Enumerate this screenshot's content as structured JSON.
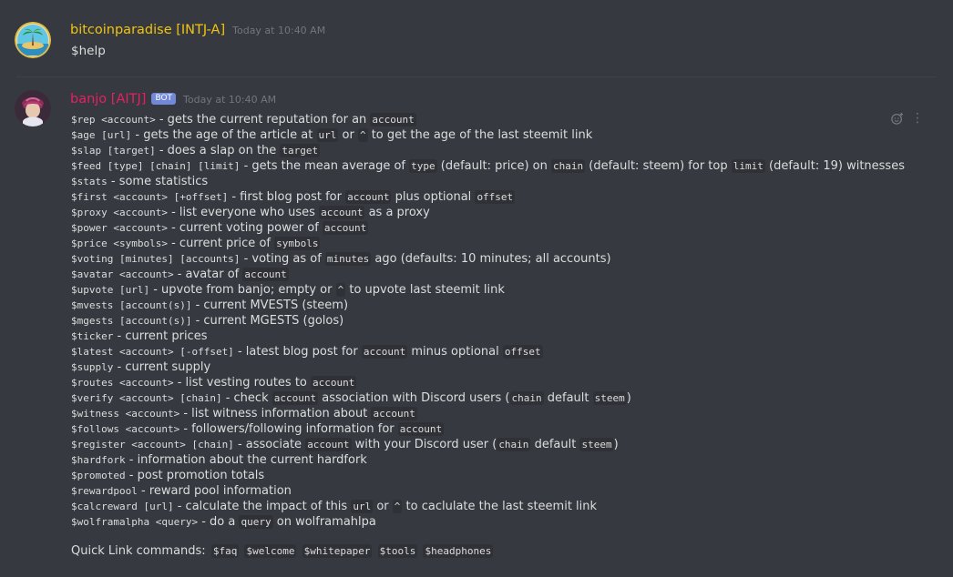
{
  "messages": [
    {
      "username": "bitcoinparadise [INTJ-A]",
      "username_color": "#f1c40f",
      "timestamp": "Today at 10:40 AM",
      "text": "$help"
    },
    {
      "username": "banjo [AITJ]",
      "username_color": "#e91e63",
      "bot_badge": "BOT",
      "timestamp": "Today at 10:40 AM"
    }
  ],
  "help_lines": [
    [
      {
        "c": "$rep <account>"
      },
      {
        "t": " - gets the current reputation for an "
      },
      {
        "c": "account"
      }
    ],
    [
      {
        "c": "$age [url]"
      },
      {
        "t": " - gets the age of the article at "
      },
      {
        "c": "url"
      },
      {
        "t": " or "
      },
      {
        "c": "^"
      },
      {
        "t": " to get the age of the last steemit link"
      }
    ],
    [
      {
        "c": "$slap [target]"
      },
      {
        "t": " - does a slap on the "
      },
      {
        "c": "target"
      }
    ],
    [
      {
        "c": "$feed [type] [chain] [limit]"
      },
      {
        "t": " - gets the mean average of "
      },
      {
        "c": "type"
      },
      {
        "t": " (default: price) on "
      },
      {
        "c": "chain"
      },
      {
        "t": " (default: steem) for top "
      },
      {
        "c": "limit"
      },
      {
        "t": " (default: 19) witnesses"
      }
    ],
    [
      {
        "c": "$stats"
      },
      {
        "t": " - some statistics"
      }
    ],
    [
      {
        "c": "$first <account> [+offset]"
      },
      {
        "t": " - first blog post for "
      },
      {
        "c": "account"
      },
      {
        "t": " plus optional "
      },
      {
        "c": "offset"
      }
    ],
    [
      {
        "c": "$proxy <account>"
      },
      {
        "t": " - list everyone who uses "
      },
      {
        "c": "account"
      },
      {
        "t": " as a proxy"
      }
    ],
    [
      {
        "c": "$power <account>"
      },
      {
        "t": " - current voting power of "
      },
      {
        "c": "account"
      }
    ],
    [
      {
        "c": "$price <symbols>"
      },
      {
        "t": " - current price of "
      },
      {
        "c": "symbols"
      }
    ],
    [
      {
        "c": "$voting [minutes] [accounts]"
      },
      {
        "t": " - voting as of "
      },
      {
        "c": "minutes"
      },
      {
        "t": " ago (defaults: 10 minutes; all accounts)"
      }
    ],
    [
      {
        "c": "$avatar <account>"
      },
      {
        "t": " - avatar of "
      },
      {
        "c": "account"
      }
    ],
    [
      {
        "c": "$upvote [url]"
      },
      {
        "t": " - upvote from banjo; empty or "
      },
      {
        "c": "^"
      },
      {
        "t": " to upvote last steemit link"
      }
    ],
    [
      {
        "c": "$mvests [account(s)]"
      },
      {
        "t": " - current MVESTS (steem)"
      }
    ],
    [
      {
        "c": "$mgests [account(s)]"
      },
      {
        "t": " - current MGESTS (golos)"
      }
    ],
    [
      {
        "c": "$ticker"
      },
      {
        "t": " - current prices"
      }
    ],
    [
      {
        "c": "$latest <account> [-offset]"
      },
      {
        "t": " - latest blog post for "
      },
      {
        "c": "account"
      },
      {
        "t": " minus optional "
      },
      {
        "c": "offset"
      }
    ],
    [
      {
        "c": "$supply"
      },
      {
        "t": " - current supply"
      }
    ],
    [
      {
        "c": "$routes <account>"
      },
      {
        "t": " - list vesting routes to "
      },
      {
        "c": "account"
      }
    ],
    [
      {
        "c": "$verify <account> [chain]"
      },
      {
        "t": " - check "
      },
      {
        "c": "account"
      },
      {
        "t": " association with Discord users ("
      },
      {
        "c": "chain"
      },
      {
        "t": " default "
      },
      {
        "c": "steem"
      },
      {
        "t": ")"
      }
    ],
    [
      {
        "c": "$witness <account>"
      },
      {
        "t": " - list witness information about "
      },
      {
        "c": "account"
      }
    ],
    [
      {
        "c": "$follows <account>"
      },
      {
        "t": " - followers/following information for "
      },
      {
        "c": "account"
      }
    ],
    [
      {
        "c": "$register <account> [chain]"
      },
      {
        "t": " - associate "
      },
      {
        "c": "account"
      },
      {
        "t": " with your Discord user ("
      },
      {
        "c": "chain"
      },
      {
        "t": " default "
      },
      {
        "c": "steem"
      },
      {
        "t": ")"
      }
    ],
    [
      {
        "c": "$hardfork"
      },
      {
        "t": " - information about the current hardfork"
      }
    ],
    [
      {
        "c": "$promoted"
      },
      {
        "t": " - post promotion totals"
      }
    ],
    [
      {
        "c": "$rewardpool"
      },
      {
        "t": " - reward pool information"
      }
    ],
    [
      {
        "c": "$calcreward [url]"
      },
      {
        "t": " - calculate the impact of this "
      },
      {
        "c": "url"
      },
      {
        "t": " or "
      },
      {
        "c": "^"
      },
      {
        "t": " to caclulate the last steemit link"
      }
    ],
    [
      {
        "c": "$wolframalpha <query>"
      },
      {
        "t": " - do a "
      },
      {
        "c": "query"
      },
      {
        "t": " on wolframahlpa"
      }
    ]
  ],
  "quick_links": {
    "label": "Quick Link commands:",
    "commands": [
      "$faq",
      "$welcome",
      "$whitepaper",
      "$tools",
      "$headphones"
    ]
  },
  "icons": {
    "reaction": "add-reaction-icon",
    "more": "more-options-icon"
  },
  "colors": {
    "background": "#36393f",
    "code_bg": "#2f3136",
    "timestamp": "#72767d",
    "bot_badge": "#7289da"
  }
}
